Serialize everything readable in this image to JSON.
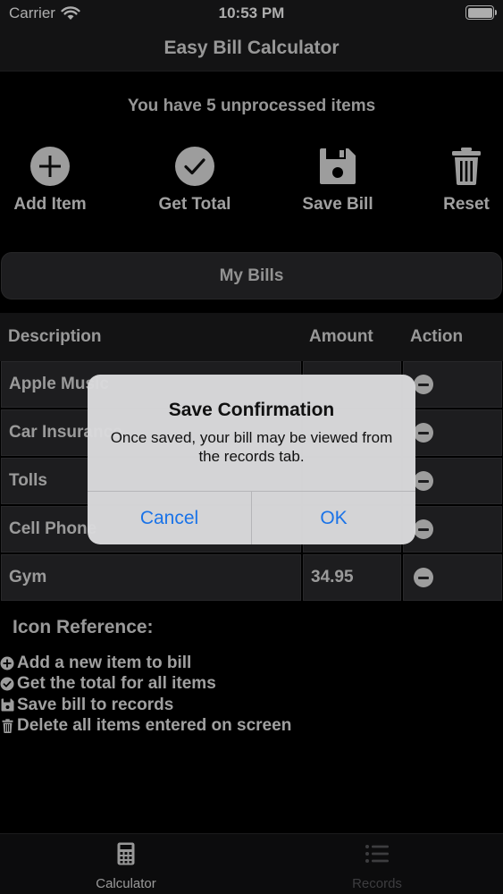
{
  "status": {
    "carrier": "Carrier",
    "time": "10:53 PM"
  },
  "nav": {
    "title": "Easy Bill Calculator"
  },
  "summary": {
    "unprocessed": "You have 5 unprocessed items"
  },
  "toolbar": {
    "add_label": "Add Item",
    "total_label": "Get Total",
    "save_label": "Save Bill",
    "reset_label": "Reset"
  },
  "my_bills": {
    "label": "My Bills"
  },
  "table": {
    "headers": {
      "description": "Description",
      "amount": "Amount",
      "action": "Action"
    },
    "rows": [
      {
        "description": "Apple Music",
        "amount": ""
      },
      {
        "description": "Car Insurance",
        "amount": ""
      },
      {
        "description": "Tolls",
        "amount": ""
      },
      {
        "description": "Cell Phone",
        "amount": ""
      },
      {
        "description": "Gym",
        "amount": "34.95"
      }
    ]
  },
  "reference": {
    "title": "Icon Reference:",
    "items": [
      {
        "icon": "plus-circle-icon",
        "text": "Add a new item to bill"
      },
      {
        "icon": "check-circle-icon",
        "text": "Get the total for all items"
      },
      {
        "icon": "floppy-disk-icon",
        "text": "Save bill to records"
      },
      {
        "icon": "trash-icon",
        "text": "Delete all items entered on screen"
      }
    ]
  },
  "tabs": {
    "calculator": "Calculator",
    "records": "Records"
  },
  "alert": {
    "title": "Save Confirmation",
    "message": "Once saved, your bill may be viewed from the records tab.",
    "cancel": "Cancel",
    "ok": "OK"
  },
  "colors": {
    "accent": "#1a73e8",
    "background": "#000000",
    "cell": "#2c2c2e"
  }
}
